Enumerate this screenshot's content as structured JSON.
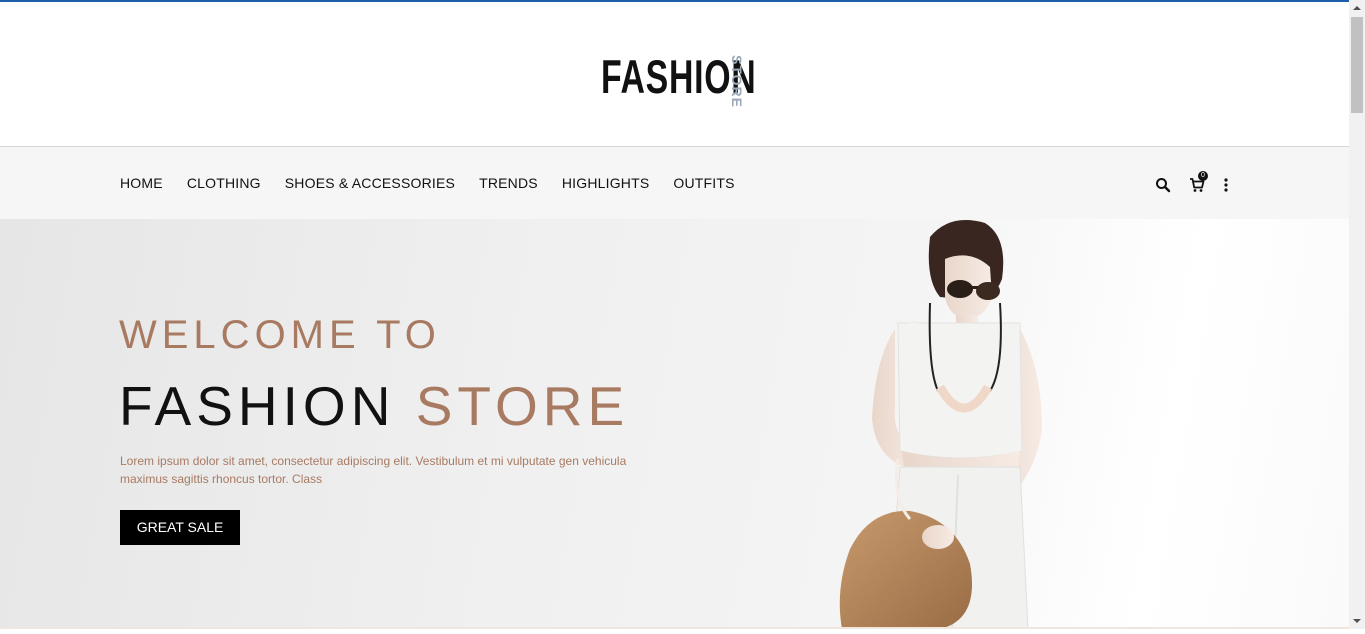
{
  "logo": {
    "main": "FASHION",
    "sub": "STORE"
  },
  "nav": {
    "items": [
      "HOME",
      "CLOTHING",
      "SHOES & ACCESSORIES",
      "TRENDS",
      "HIGHLIGHTS",
      "OUTFITS"
    ],
    "icons": [
      "search-icon",
      "cart-icon",
      "more-vertical-icon"
    ],
    "cart_count": "0"
  },
  "hero": {
    "line1": "WELCOME TO",
    "line2_a": "FASHION",
    "line2_b": "STORE",
    "description": "Lorem ipsum dolor sit amet, consectetur adipiscing elit. Vestibulum et mi vulputate gen vehicula maximus sagittis rhoncus tortor. Class",
    "button": "GREAT SALE"
  },
  "colors": {
    "accent": "#a87a62",
    "dark": "#111111",
    "topline": "#1c5fa8"
  }
}
